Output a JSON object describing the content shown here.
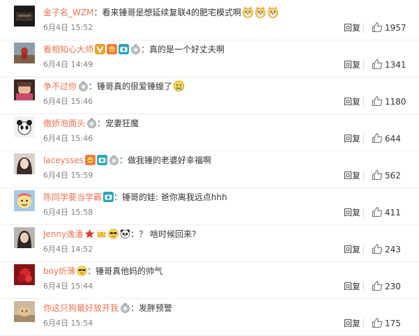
{
  "comments": [
    {
      "username": "金子名_WZM",
      "colon": "：",
      "content": "看来锤哥是想延续复联4的肥宅模式啊",
      "badges": [],
      "emojis": [
        "doge-icon",
        "doge-icon",
        "doge-icon"
      ],
      "time": "6月4日 15:52",
      "reply": "回复",
      "likes": "1957"
    },
    {
      "username": "看相知心大师",
      "colon": "：",
      "content": "真的是一个好丈夫啊",
      "badges": [
        "verified-v-icon",
        "fans-badge-icon",
        "member-camera-icon",
        "silver-medal-icon"
      ],
      "emojis": [],
      "time": "6月4日 14:49",
      "reply": "回复",
      "likes": "1341"
    },
    {
      "username": "争不过你",
      "colon": "：",
      "content": "锤哥真的很爱锤嫂了",
      "badges": [
        "silver-medal-icon"
      ],
      "emojis": [
        "tearful-face-icon"
      ],
      "time": "6月4日 15:46",
      "reply": "回复",
      "likes": "1180"
    },
    {
      "username": "傲娇泡面头",
      "colon": "：",
      "content": "宠妻狂魔",
      "badges": [
        "silver-medal-icon"
      ],
      "emojis": [],
      "time": "6月4日 15:46",
      "reply": "回复",
      "likes": "644"
    },
    {
      "username": "laceysses",
      "colon": "：",
      "content": "做我锤的老婆好幸福啊",
      "badges": [
        "fans-badge-icon",
        "member-camera-icon",
        "silver-medal-icon"
      ],
      "emojis": [],
      "time": "6月4日 15:59",
      "reply": "回复",
      "likes": "562"
    },
    {
      "username": "陈同学要当学霸",
      "colon": "：",
      "content": "锤哥的娃: 爸你离我远点hhh",
      "badges": [
        "member-camera-icon"
      ],
      "emojis": [],
      "time": "6月4日 15:58",
      "reply": "回复",
      "likes": "411"
    },
    {
      "username": "Jenny逸潘",
      "colon": "：",
      "content": "？ 啥时候回来?",
      "badges": [
        "star-icon",
        "cheers-badge-icon",
        "sunglasses-face-icon",
        "panda-icon"
      ],
      "emojis": [],
      "time": "6月4日 14:52",
      "reply": "回复",
      "likes": "243"
    },
    {
      "username": "boy炘薄",
      "colon": "：",
      "content": "锤哥真他妈的帅气",
      "badges": [
        "sunglasses-face-icon"
      ],
      "emojis": [],
      "time": "6月4日 15:44",
      "reply": "回复",
      "likes": "230"
    },
    {
      "username": "你这只狗最好放开我",
      "colon": "：",
      "content": "发胖预警",
      "badges": [
        "silver-medal-icon"
      ],
      "emojis": [],
      "time": "6月4日 15:54",
      "reply": "回复",
      "likes": "175"
    }
  ],
  "colors": {
    "username": "#eb7350",
    "text": "#333333",
    "timestamp": "#808080",
    "divider": "#ececec"
  }
}
